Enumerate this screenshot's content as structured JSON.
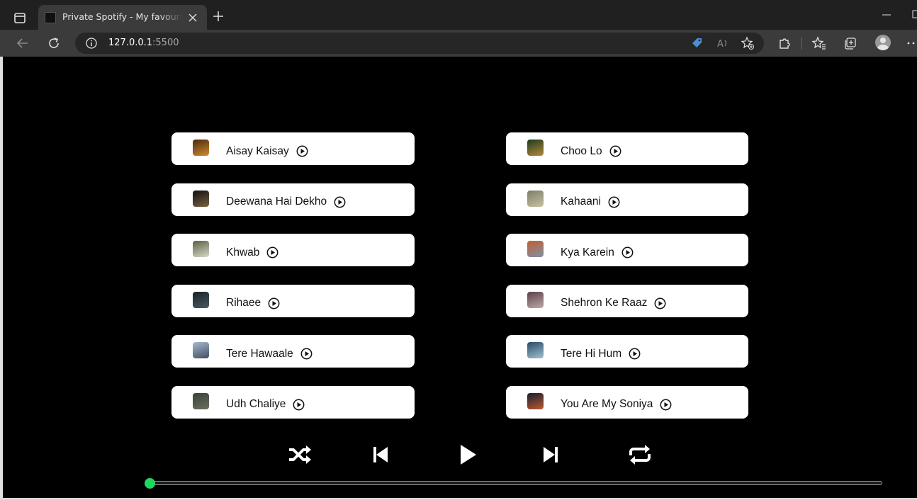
{
  "browser": {
    "tab_title": "Private Spotify - My favourite music",
    "url_host": "127.0.0.1",
    "url_port": ":5500",
    "icons": {
      "tab_actions": "tab-actions-icon",
      "close": "close-icon",
      "new_tab": "plus-icon",
      "back": "back-arrow-icon",
      "reload": "reload-icon",
      "site_info": "info-icon",
      "coupon": "tag-icon",
      "read_aloud": "read-aloud-icon",
      "favorite_add": "star-plus-icon",
      "extensions": "puzzle-icon",
      "favorites": "favorites-icon",
      "collections": "collections-icon",
      "profile": "avatar-icon",
      "menu": "ellipsis-icon"
    }
  },
  "songs": [
    {
      "name": "Aisay Kaisay",
      "thumb": [
        "#4a2a10",
        "#d08a30"
      ]
    },
    {
      "name": "Choo Lo",
      "thumb": [
        "#1e3a1a",
        "#b08a40"
      ]
    },
    {
      "name": "Deewana Hai Dekho",
      "thumb": [
        "#111111",
        "#7a6040"
      ]
    },
    {
      "name": "Kahaani",
      "thumb": [
        "#7a8068",
        "#c8c0a0"
      ]
    },
    {
      "name": "Khwab",
      "thumb": [
        "#5a6040",
        "#d8d8c8"
      ]
    },
    {
      "name": "Kya Karein",
      "thumb": [
        "#c06030",
        "#8090a8"
      ]
    },
    {
      "name": "Rihaee",
      "thumb": [
        "#1a2228",
        "#4a5a62"
      ]
    },
    {
      "name": "Shehron Ke Raaz",
      "thumb": [
        "#5a4048",
        "#c0a8a8"
      ]
    },
    {
      "name": "Tere Hawaale",
      "thumb": [
        "#a8b8d0",
        "#405060"
      ]
    },
    {
      "name": "Tere Hi Hum",
      "thumb": [
        "#2a4a68",
        "#a0c0d0"
      ]
    },
    {
      "name": "Udh Chaliye",
      "thumb": [
        "#3a4238",
        "#687060"
      ]
    },
    {
      "name": "You Are My Soniya",
      "thumb": [
        "#142030",
        "#c05830"
      ]
    }
  ],
  "player": {
    "progress": 0,
    "accent": "#1ed760",
    "controls": [
      "shuffle-icon",
      "previous-icon",
      "play-icon",
      "next-icon",
      "repeat-icon"
    ]
  }
}
